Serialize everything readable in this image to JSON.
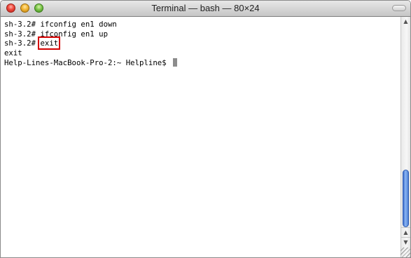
{
  "window": {
    "title": "Terminal — bash — 80×24"
  },
  "terminal": {
    "lines": [
      {
        "prompt": "sh-3.2# ",
        "command": "ifconfig en1 down"
      },
      {
        "prompt": "sh-3.2# ",
        "command": "ifconfig en1 up"
      },
      {
        "prompt": "sh-3.2# ",
        "command": "exit"
      },
      {
        "prompt": "",
        "command": "exit"
      },
      {
        "prompt": "Help-Lines-MacBook-Pro-2:~ Helpline$ ",
        "command": ""
      }
    ],
    "highlight_color": "#d40000"
  },
  "icons": {
    "close": "close-icon",
    "minimize": "minimize-icon",
    "zoom": "zoom-icon",
    "scroll_up": "chevron-up-icon",
    "scroll_down": "chevron-down-icon",
    "resize": "resize-grip-icon"
  },
  "scroll": {
    "up_glyph": "▲",
    "down_glyph": "▼"
  }
}
